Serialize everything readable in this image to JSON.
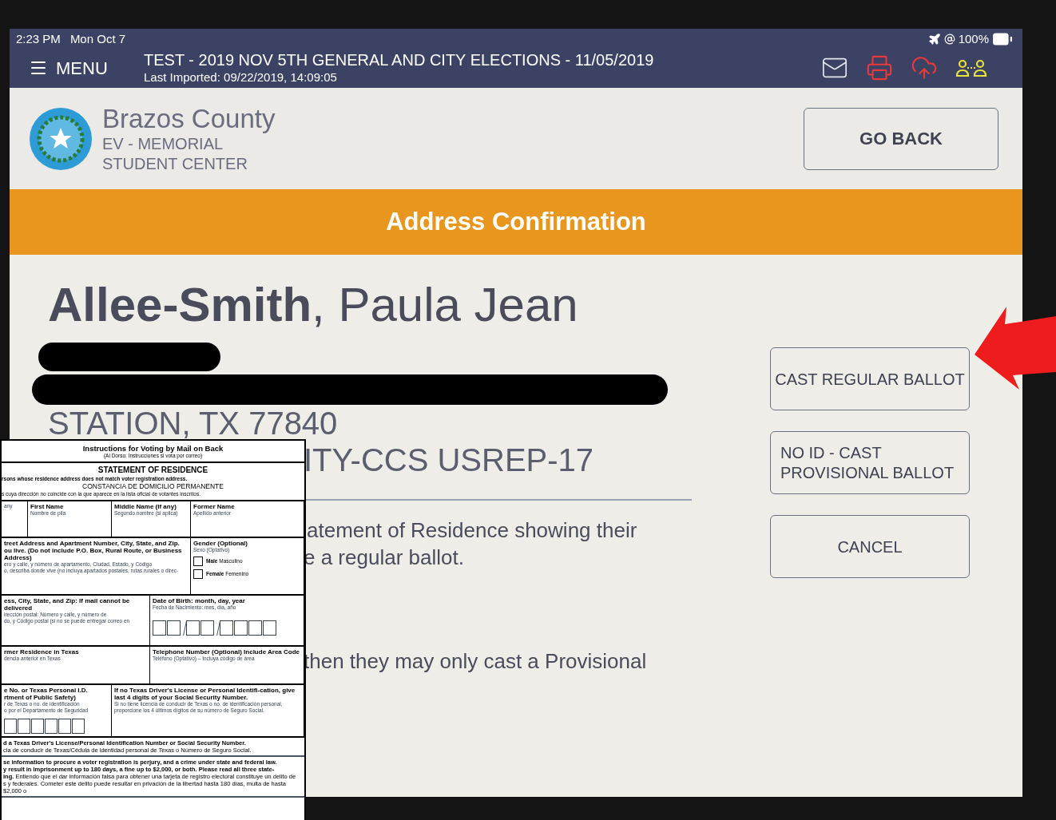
{
  "status_bar": {
    "time": "2:23 PM",
    "date": "Mon Oct 7",
    "battery": "100%"
  },
  "nav": {
    "menu": "MENU",
    "title": "TEST - 2019 NOV 5TH GENERAL AND CITY ELECTIONS - 11/05/2019",
    "subtitle": "Last Imported: 09/22/2019, 14:09:05"
  },
  "header": {
    "county": "Brazos County",
    "location_lines": [
      "EV - MEMORIAL",
      "STUDENT CENTER"
    ],
    "back_button": "GO BACK"
  },
  "banner": "Address Confirmation",
  "voter": {
    "name": "**Allee-Smith**, Paula Jean",
    "address_lines": [
      "STATION, TX 77840",
      "ITY-CCS USREP-17"
    ]
  },
  "message_lines": [
    "atement of Residence showing their",
    "e a regular ballot.",
    "then they may only cast a Provisional"
  ],
  "actions": [
    {
      "label": "CAST REGULAR BALLOT"
    },
    {
      "label": "NO ID - CAST PROVISIONAL BALLOT"
    },
    {
      "label": "CANCEL"
    }
  ],
  "form": {
    "heading": "Instructions for Voting by Mail on Back",
    "heading_note": "(Al Dorso:  Instrucciones si vota por correo)",
    "title": "STATEMENT OF RESIDENCE",
    "title_line": "rsons whose residence address does not match voter registration address.",
    "spanish_title": "CONSTANCIA DE DOMICILIO PERMANENTE",
    "spanish_line": "s cuya dirección no coincide con la que aparece en la lista oficial de votantes inscritos.",
    "sections": [
      {
        "cells": [
          {
            "kind": "text",
            "lines": [
              {
                "kind": "note",
                "text": "any"
              }
            ]
          },
          {
            "kind": "text",
            "lines": [
              {
                "kind": "title",
                "text": "First Name"
              },
              {
                "kind": "note",
                "text": "Nombre de pila"
              }
            ]
          },
          {
            "kind": "text",
            "lines": [
              {
                "kind": "title",
                "text": "Middle Name (If any)"
              },
              {
                "kind": "note",
                "text": "Segundo nombre (si aplica)"
              }
            ]
          },
          {
            "kind": "text",
            "lines": [
              {
                "kind": "title",
                "text": "Former Name"
              },
              {
                "kind": "note",
                "text": "Apellido anterior"
              }
            ]
          }
        ]
      },
      {
        "cells": [
          {
            "kind": "text",
            "lines": [
              {
                "kind": "title",
                "text": "treet Address and Apartment Number, City, State, and Zip."
              },
              {
                "kind": "title",
                "text": "ou live. (Do not include P.O. Box, Rural Route, or Business Address)"
              },
              {
                "kind": "note",
                "text": "ero y calle, y número de apartamento, Ciudad, Estado, y Código"
              },
              {
                "kind": "note",
                "text": "o, describa donde vive (no incluya apartados postales, rutas rurales o direc-"
              }
            ]
          },
          {
            "kind": "gender",
            "lines": [
              {
                "kind": "title",
                "text": "Gender (Optional)"
              },
              {
                "kind": "note",
                "text": "Sexo (Optativo)"
              }
            ],
            "checkboxes": [
              {
                "label": "**Male** Masculino",
                "checked": false
              },
              {
                "label": "**Female** Femenino",
                "checked": false
              }
            ]
          }
        ]
      },
      {
        "cells": [
          {
            "kind": "text",
            "lines": [
              {
                "kind": "title",
                "text": "ess, City, State, and Zip: If mail cannot be delivered"
              },
              {
                "kind": "note",
                "text": "irección postal: Número y calle, y número de"
              },
              {
                "kind": "note",
                "text": "do, y Código postal (si no se puede entregar correo en"
              }
            ]
          },
          {
            "kind": "date",
            "lines": [
              {
                "kind": "title",
                "text": "Date of Birth: month, day, year"
              },
              {
                "kind": "note",
                "text": "Fecha de Nacimiento: mes, día, año"
              }
            ]
          }
        ]
      },
      {
        "cells": [
          {
            "kind": "text",
            "lines": [
              {
                "kind": "title",
                "text": "rmer Residence in Texas"
              },
              {
                "kind": "note",
                "text": "dencia anterior en Texas"
              }
            ]
          },
          {
            "kind": "text",
            "lines": [
              {
                "kind": "title",
                "text": "Telephone Number (Optional) Include Area Code"
              },
              {
                "kind": "note",
                "text": "Teléfono (Optativo) – Incluya código de área"
              }
            ]
          }
        ]
      },
      {
        "cells": [
          {
            "kind": "id",
            "lines": [
              {
                "kind": "title",
                "text": "e No. or Texas Personal I.D."
              },
              {
                "kind": "title",
                "text": "rtment of Public Safety)"
              },
              {
                "kind": "note",
                "text": "r de Texas o no. de identificación"
              },
              {
                "kind": "note",
                "text": "o por el Departamento de Seguridad"
              }
            ]
          },
          {
            "kind": "text",
            "lines": [
              {
                "kind": "title",
                "text": "If no Texas Driver's License or Personal Identifi-cation, give last 4 digits of your Social Security Number."
              },
              {
                "kind": "note",
                "text": "Si no tiene licencia de conducir de Texas o no. de identificación personal, proporcione los 4 últimos dígitos de su número de Seguro Social."
              }
            ]
          }
        ]
      }
    ],
    "footer_groups": [
      [
        "**d a Texas Driver's License/Personal Identification Number or Social Security Number.**",
        "cia de conducir de Texas/Cédula de identidad personal de Texas o Número de Seguro Social."
      ],
      [
        "**se information to procure a voter registration is perjury, and a crime under state and federal law.**",
        "**y result in imprisonment up to 180 days, a fine up to $2,000, or both. Please read all three state-**",
        "**ing.** Entiendo que el dar información falsa para obtener una tarjeta de registro electoral constituye un delito de",
        "s y federales. Cometer este delito puede resultar en privación de la libertad hasta 180 días, multa de hasta $2,000 o"
      ]
    ]
  }
}
